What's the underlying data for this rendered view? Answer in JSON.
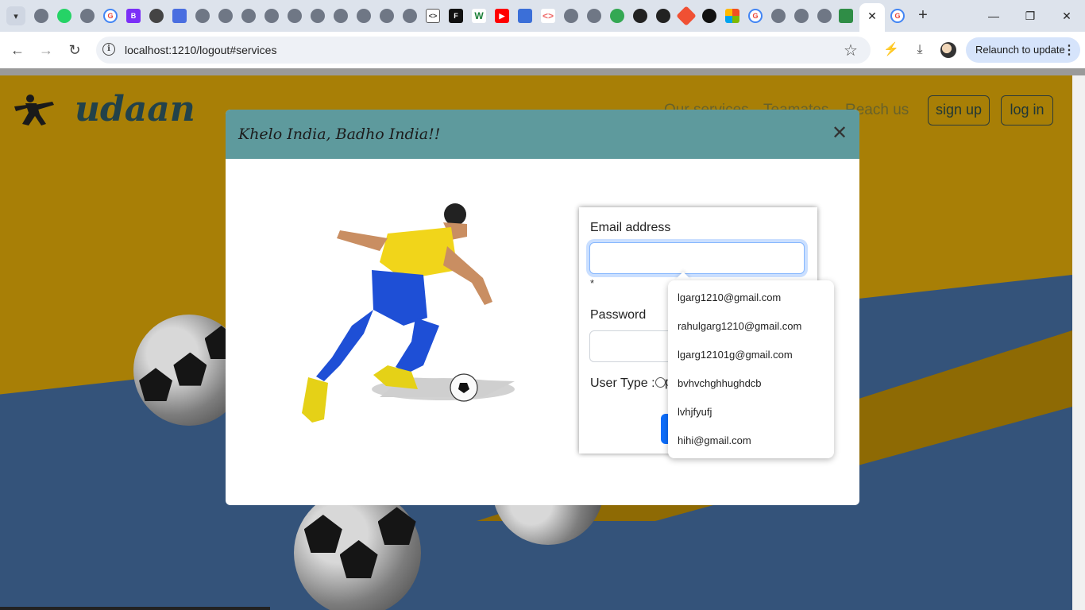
{
  "browser": {
    "url": "localhost:1210/logout#services",
    "relaunch_label": "Relaunch to update",
    "tab_favicons": [
      "chrome-icon",
      "whatsapp-icon",
      "chrome-icon",
      "google-icon",
      "bootstrap-icon",
      "openai-icon",
      "forms-icon",
      "globe-icon",
      "globe-icon",
      "globe-icon",
      "globe-icon",
      "globe-icon",
      "globe-icon",
      "globe-icon",
      "globe-icon",
      "code-icon",
      "figma-icon",
      "webflow-icon",
      "youtube-icon",
      "flag-icon",
      "code-brackets-icon",
      "globe-icon",
      "globe-icon",
      "maps-icon",
      "github-icon",
      "github-icon",
      "git-icon",
      "dark-circle-icon",
      "microsoft-icon",
      "google-icon",
      "globe-icon",
      "globe-icon",
      "globe-icon",
      "geeksforgeeks-icon",
      "google-icon"
    ],
    "accent": "#d6e4fb"
  },
  "site": {
    "brand": "udaan",
    "nav": [
      "Our services",
      "Teamates",
      "Reach us"
    ],
    "signup_label": "sign up",
    "login_label": "log in"
  },
  "modal": {
    "title": "Khelo India, Badho India!!",
    "email_label": "Email address",
    "required_mark": "*",
    "password_label": "Password",
    "user_type_label": "User Type :",
    "radio_first_letter": "p"
  },
  "autocomplete": {
    "suggestions": [
      "lgarg1210@gmail.com",
      "rahulgarg1210@gmail.com",
      "lgarg12101g@gmail.com",
      "bvhvchghhughdcb",
      "lvhjfyufj",
      "hihi@gmail.com"
    ]
  },
  "colors": {
    "modal_header": "#5e9a9d",
    "primary_button": "#0d6efd",
    "page_bg": "#a87f06"
  }
}
